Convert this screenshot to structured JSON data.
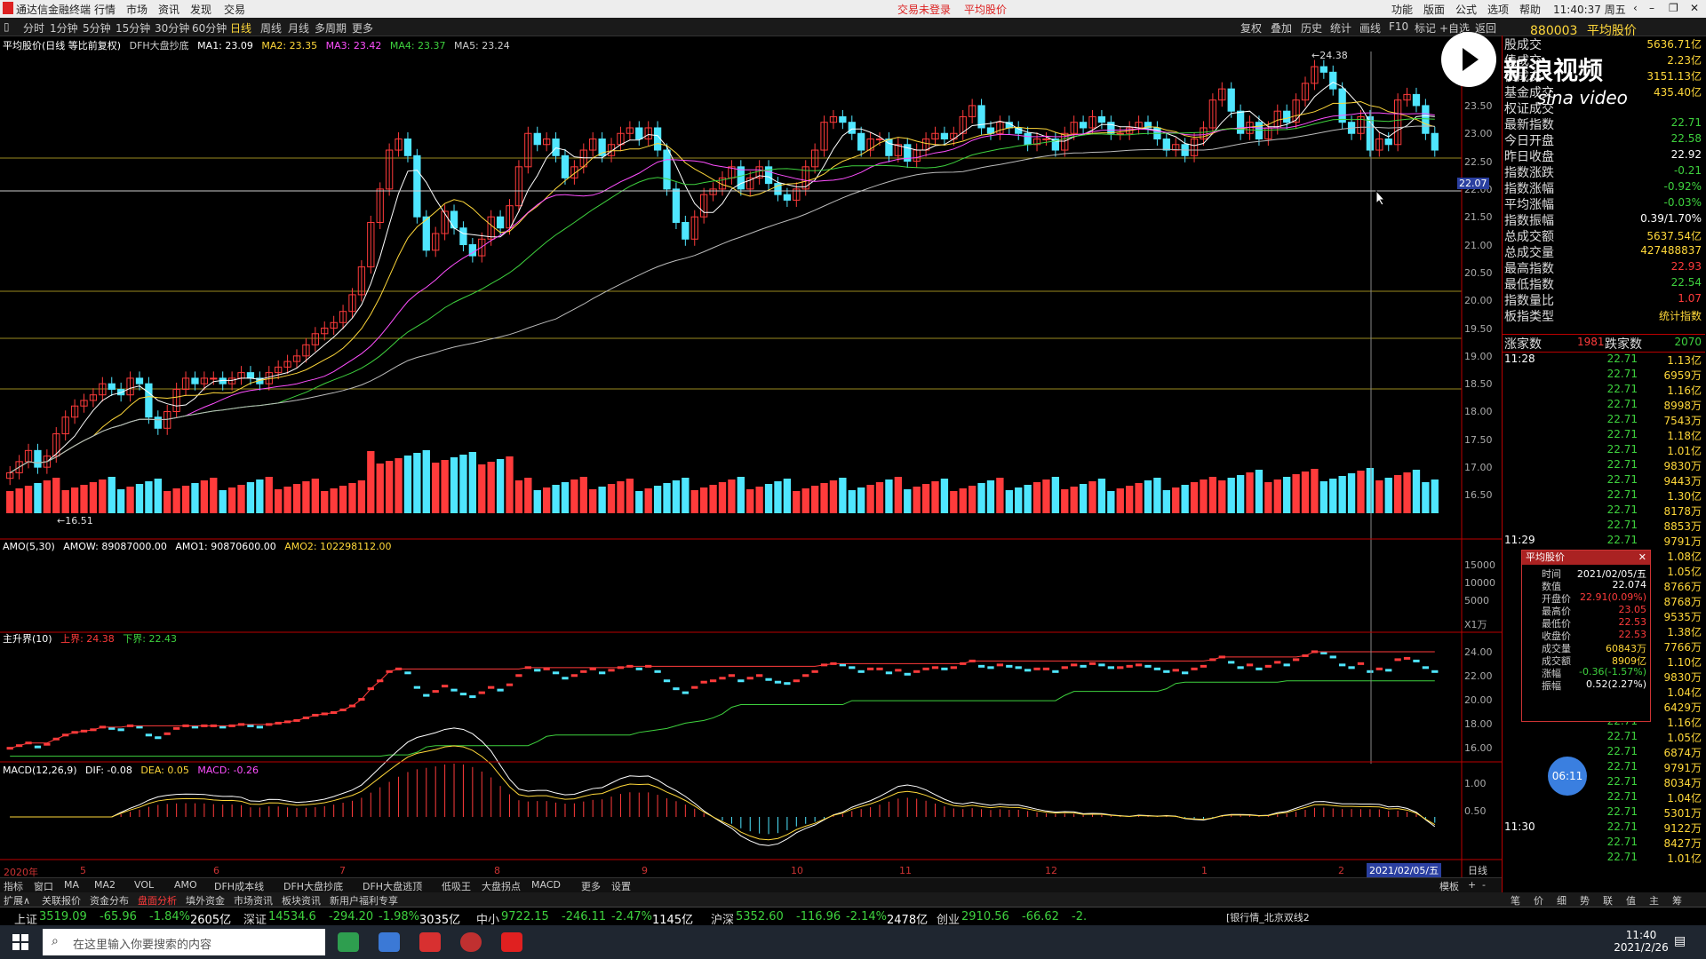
{
  "app": {
    "title": "通达信金融终端",
    "menus": [
      "行情",
      "市场",
      "资讯",
      "发现",
      "交易"
    ],
    "center": [
      "交易未登录",
      "平均股价"
    ],
    "right_menus": [
      "功能",
      "版面",
      "公式",
      "选项",
      "帮助"
    ],
    "clock": "11:40:37 周五"
  },
  "periods": [
    "分时",
    "1分钟",
    "5分钟",
    "15分钟",
    "30分钟",
    "60分钟",
    "日线",
    "周线",
    "月线",
    "多周期",
    "更多"
  ],
  "tools": [
    "复权",
    "叠加",
    "历史",
    "统计",
    "画线",
    "F10",
    "标记",
    "+自选",
    "返回"
  ],
  "stock": {
    "code": "880003",
    "name": "平均股价"
  },
  "main_panel": {
    "label": "平均股价(日线 等比前复权)",
    "indicator": "DFH大盘抄底",
    "ma1": "MA1: 23.09",
    "ma2": "MA2: 23.35",
    "ma3": "MA3: 23.42",
    "ma4": "MA4: 23.37",
    "ma5": "MA5: 23.24",
    "high_mark": "24.38",
    "low_mark": "16.51",
    "cursor_price": "22.07"
  },
  "price_axis": [
    "23.50",
    "23.00",
    "22.50",
    "22.00",
    "21.50",
    "21.00",
    "20.50",
    "20.00",
    "19.50",
    "19.00",
    "18.50",
    "18.00",
    "17.50",
    "17.00",
    "16.50"
  ],
  "amo_panel": {
    "label": "AMO(5,30)",
    "amow": "AMOW: 89087000.00",
    "amo1": "AMO1: 90870600.00",
    "amo2": "AMO2: 102298112.00",
    "axis": [
      "15000",
      "10000",
      "5000",
      "X1万"
    ]
  },
  "zsj_panel": {
    "label": "主升界(10)",
    "up": "上界: 24.38",
    "down": "下界: 22.43",
    "axis": [
      "24.00",
      "22.00",
      "20.00",
      "18.00",
      "16.00"
    ]
  },
  "macd_panel": {
    "label": "MACD(12,26,9)",
    "dif": "DIF: -0.08",
    "dea": "DEA: 0.05",
    "macd": "MACD: -0.26",
    "axis": [
      "1.00",
      "0.50"
    ]
  },
  "time_axis": {
    "labels": [
      "2020年",
      "5",
      "6",
      "7",
      "8",
      "9",
      "10",
      "11",
      "12",
      "1",
      "2"
    ],
    "cursor": "2021/02/05/五",
    "period": "日线"
  },
  "right_info": [
    {
      "label": "股成交",
      "value": "5636.71亿",
      "color": "yellow"
    },
    {
      "label": "债成交",
      "value": "2.23亿",
      "color": "yellow"
    },
    {
      "label": "债成交",
      "value": "3151.13亿",
      "color": "yellow"
    },
    {
      "label": "基金成交",
      "value": "435.40亿",
      "color": "yellow"
    },
    {
      "label": "权证成交",
      "value": "",
      "color": "yellow"
    },
    {
      "label": "最新指数",
      "value": "22.71",
      "color": "green"
    },
    {
      "label": "今日开盘",
      "value": "22.58",
      "color": "green"
    },
    {
      "label": "昨日收盘",
      "value": "22.92",
      "color": "white"
    },
    {
      "label": "指数涨跌",
      "value": "-0.21",
      "color": "green"
    },
    {
      "label": "指数涨幅",
      "value": "-0.92%",
      "color": "green"
    },
    {
      "label": "平均涨幅",
      "value": "-0.03%",
      "color": "green"
    },
    {
      "label": "指数振幅",
      "value": "0.39/1.70%",
      "color": "white"
    },
    {
      "label": "总成交额",
      "value": "5637.54亿",
      "color": "yellow"
    },
    {
      "label": "总成交量",
      "value": "427488837",
      "color": "yellow"
    },
    {
      "label": "最高指数",
      "value": "22.93",
      "color": "red"
    },
    {
      "label": "最低指数",
      "value": "22.54",
      "color": "green"
    },
    {
      "label": "指数量比",
      "value": "1.07",
      "color": "red"
    },
    {
      "label": "板指类型",
      "value": "统计指数",
      "color": "yellow"
    }
  ],
  "updown": {
    "up_label": "涨家数",
    "up": "1981",
    "down_label": "跌家数",
    "down": "2070"
  },
  "ticks": [
    {
      "t": "11:28",
      "p": "22.71",
      "v": "1.13亿"
    },
    {
      "t": "",
      "p": "22.71",
      "v": "6959万"
    },
    {
      "t": "",
      "p": "22.71",
      "v": "1.16亿"
    },
    {
      "t": "",
      "p": "22.71",
      "v": "8998万"
    },
    {
      "t": "",
      "p": "22.71",
      "v": "7543万"
    },
    {
      "t": "",
      "p": "22.71",
      "v": "1.18亿"
    },
    {
      "t": "",
      "p": "22.71",
      "v": "1.01亿"
    },
    {
      "t": "",
      "p": "22.71",
      "v": "9830万"
    },
    {
      "t": "",
      "p": "22.71",
      "v": "9443万"
    },
    {
      "t": "",
      "p": "22.71",
      "v": "1.30亿"
    },
    {
      "t": "",
      "p": "22.71",
      "v": "8178万"
    },
    {
      "t": "",
      "p": "22.71",
      "v": "8853万"
    },
    {
      "t": "11:29",
      "p": "22.71",
      "v": "9791万"
    },
    {
      "t": "",
      "p": "",
      "v": "1.08亿"
    },
    {
      "t": "",
      "p": "",
      "v": "1.05亿"
    },
    {
      "t": "",
      "p": "",
      "v": "8766万"
    },
    {
      "t": "",
      "p": "",
      "v": "8768万"
    },
    {
      "t": "",
      "p": "",
      "v": "9535万"
    },
    {
      "t": "",
      "p": "",
      "v": "1.38亿"
    },
    {
      "t": "",
      "p": "",
      "v": "7766万"
    },
    {
      "t": "",
      "p": "",
      "v": "1.10亿"
    },
    {
      "t": "",
      "p": "",
      "v": "9830万"
    },
    {
      "t": "",
      "p": "",
      "v": "1.04亿"
    },
    {
      "t": "",
      "p": "",
      "v": "6429万"
    },
    {
      "t": "",
      "p": "22.71",
      "v": "1.16亿"
    },
    {
      "t": "",
      "p": "22.71",
      "v": "1.05亿"
    },
    {
      "t": "",
      "p": "22.71",
      "v": "6874万"
    },
    {
      "t": "",
      "p": "22.71",
      "v": "9791万"
    },
    {
      "t": "",
      "p": "22.71",
      "v": "8034万"
    },
    {
      "t": "",
      "p": "22.71",
      "v": "1.04亿"
    },
    {
      "t": "",
      "p": "22.71",
      "v": "5301万"
    },
    {
      "t": "11:30",
      "p": "22.71",
      "v": "9122万"
    },
    {
      "t": "",
      "p": "22.71",
      "v": "8427万"
    },
    {
      "t": "",
      "p": "22.71",
      "v": "1.01亿"
    }
  ],
  "tooltip": {
    "title": "平均股价",
    "rows": [
      {
        "k": "时间",
        "v": "2021/02/05/五",
        "c": "white"
      },
      {
        "k": "数值",
        "v": "22.074",
        "c": "white"
      },
      {
        "k": "开盘价",
        "v": "22.91(0.09%)",
        "c": "red"
      },
      {
        "k": "最高价",
        "v": "23.05",
        "c": "red"
      },
      {
        "k": "最低价",
        "v": "22.53",
        "c": "red"
      },
      {
        "k": "收盘价",
        "v": "22.53",
        "c": "red"
      },
      {
        "k": "成交量",
        "v": "60843万",
        "c": "yellow"
      },
      {
        "k": "成交额",
        "v": "8909亿",
        "c": "yellow"
      },
      {
        "k": "涨幅",
        "v": "-0.36(-1.57%)",
        "c": "green"
      },
      {
        "k": "振幅",
        "v": "0.52(2.27%)",
        "c": "white"
      }
    ]
  },
  "overlay": {
    "brand": "新浪视频",
    "brand_en": "sina video",
    "timer": "06:11"
  },
  "bottom_tabs1": [
    "指标",
    "窗口",
    "MA",
    "MA2",
    "VOL",
    "AMO",
    "DFH成本线",
    "DFH大盘抄底",
    "DFH大盘逃顶",
    "低吸王",
    "大盘拐点",
    "MACD",
    "更多",
    "设置"
  ],
  "bottom_tabs1_right": [
    "模板",
    "+",
    "-"
  ],
  "bottom_tabs2": [
    "扩展∧",
    "关联报价",
    "资金分布",
    "盘面分析",
    "填外资金",
    "市场资讯",
    "板块资讯",
    "新用户福利专享"
  ],
  "right_bottom_tabs": [
    "笔",
    "价",
    "细",
    "势",
    "联",
    "值",
    "主",
    "筹"
  ],
  "index_bar": [
    {
      "name": "上证",
      "val": "3519.09",
      "chg": "-65.96",
      "pct": "-1.84%",
      "amt": "2605亿"
    },
    {
      "name": "深证",
      "val": "14534.6",
      "chg": "-294.20",
      "pct": "-1.98%",
      "amt": "3035亿"
    },
    {
      "name": "中小",
      "val": "9722.15",
      "chg": "-246.11",
      "pct": "-2.47%",
      "amt": "1145亿"
    },
    {
      "name": "沪深",
      "val": "5352.60",
      "chg": "-116.96",
      "pct": "-2.14%",
      "amt": "2478亿"
    },
    {
      "name": "创业",
      "val": "2910.56",
      "chg": "-66.62",
      "pct": "-2.",
      "amt": ""
    }
  ],
  "index_bar_tail": "[银行情_北京双线2",
  "taskbar": {
    "search_placeholder": "在这里输入你要搜索的内容",
    "time": "11:40",
    "date": "2021/2/26"
  },
  "chart_data": {
    "type": "candlestick",
    "title": "平均股价(日线 等比前复权)",
    "ylim": [
      16.3,
      24.6
    ],
    "closes": [
      16.9,
      17.1,
      17.3,
      17.0,
      17.2,
      17.6,
      17.9,
      18.1,
      18.2,
      18.3,
      18.5,
      18.4,
      18.3,
      18.6,
      18.5,
      17.9,
      17.7,
      18.0,
      18.4,
      18.6,
      18.5,
      18.6,
      18.6,
      18.5,
      18.6,
      18.7,
      18.6,
      18.5,
      18.7,
      18.8,
      18.9,
      19.0,
      19.2,
      19.4,
      19.5,
      19.6,
      19.8,
      20.1,
      20.6,
      21.4,
      22.0,
      22.7,
      22.9,
      22.6,
      21.5,
      20.9,
      21.2,
      21.6,
      21.3,
      21.0,
      20.8,
      21.1,
      21.5,
      21.3,
      21.7,
      22.4,
      23.0,
      22.8,
      22.9,
      22.6,
      22.2,
      22.4,
      22.7,
      22.9,
      22.6,
      22.8,
      23.0,
      23.1,
      22.9,
      23.1,
      22.7,
      22.0,
      21.4,
      21.1,
      21.5,
      21.9,
      22.0,
      22.2,
      22.4,
      22.0,
      22.2,
      22.4,
      22.1,
      21.9,
      21.8,
      22.0,
      22.4,
      22.7,
      23.2,
      23.3,
      23.2,
      23.0,
      22.7,
      22.9,
      22.9,
      22.6,
      22.8,
      22.5,
      22.7,
      22.9,
      23.0,
      22.9,
      23.0,
      23.3,
      23.5,
      23.1,
      23.0,
      23.2,
      23.1,
      23.0,
      22.8,
      22.9,
      22.9,
      22.7,
      23.0,
      23.2,
      23.1,
      23.3,
      23.2,
      23.0,
      23.0,
      23.1,
      23.2,
      23.1,
      22.9,
      22.7,
      22.8,
      22.6,
      22.9,
      23.1,
      23.6,
      23.8,
      23.4,
      23.0,
      23.2,
      22.9,
      23.1,
      23.4,
      23.2,
      23.6,
      23.9,
      24.2,
      24.1,
      23.8,
      23.2,
      23.0,
      23.3,
      22.7,
      22.9,
      22.8,
      23.6,
      23.7,
      23.5,
      23.0,
      22.7
    ],
    "note_series": [
      "MA1",
      "MA2",
      "MA3",
      "MA4",
      "MA5"
    ]
  }
}
